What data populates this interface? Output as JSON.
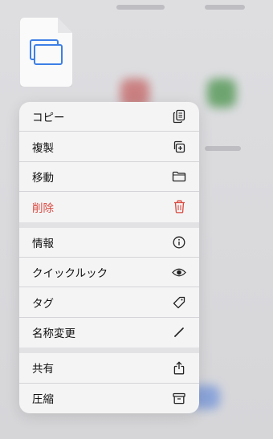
{
  "menu": {
    "groups": [
      {
        "items": [
          {
            "label": "コピー",
            "icon": "copy-icon"
          },
          {
            "label": "複製",
            "icon": "duplicate-icon"
          },
          {
            "label": "移動",
            "icon": "folder-icon"
          },
          {
            "label": "削除",
            "icon": "trash-icon",
            "destructive": true
          }
        ]
      },
      {
        "items": [
          {
            "label": "情報",
            "icon": "info-icon"
          },
          {
            "label": "クイックルック",
            "icon": "eye-icon"
          },
          {
            "label": "タグ",
            "icon": "tag-icon"
          },
          {
            "label": "名称変更",
            "icon": "pencil-icon"
          }
        ]
      },
      {
        "items": [
          {
            "label": "共有",
            "icon": "share-icon"
          },
          {
            "label": "圧縮",
            "icon": "archive-icon"
          }
        ]
      }
    ]
  },
  "colors": {
    "destructive": "#d9463c",
    "accent": "#3d7fe6"
  }
}
